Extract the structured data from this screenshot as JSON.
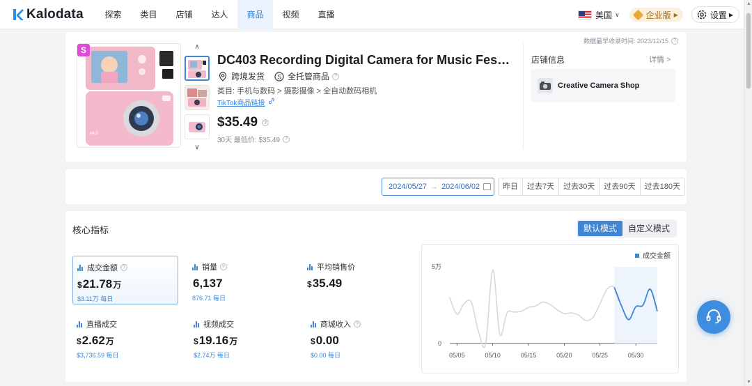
{
  "app": {
    "name": "Kalodata"
  },
  "nav": {
    "items": [
      {
        "label": "探索"
      },
      {
        "label": "类目"
      },
      {
        "label": "店铺"
      },
      {
        "label": "达人"
      },
      {
        "label": "商品"
      },
      {
        "label": "视频"
      },
      {
        "label": "直播"
      }
    ],
    "active_index": 4,
    "country": "美国",
    "enterprise": "企业版",
    "settings": "设置"
  },
  "timestamp": "数据最早收录时间: 2023/12/15",
  "product": {
    "badge": "S",
    "title": "DC403 Recording Digital Camera for Music Festiva...",
    "shipping": "跨境发货",
    "managed": "全托管商品",
    "category": "类目: 手机与数码 > 摄影摄像 > 全自动数码相机",
    "tiktok_link": "TikTok商品链接",
    "price": "$35.49",
    "low_price": "30天 最低价: $35.49",
    "image_text": "44.0"
  },
  "shop": {
    "label": "店铺信息",
    "detail": "详情 >",
    "name": "Creative Camera Shop"
  },
  "date": {
    "start": "2024/05/27",
    "end": "2024/06/02",
    "quick": [
      "昨日",
      "过去7天",
      "过去30天",
      "过去90天",
      "过去180天"
    ]
  },
  "metrics_section": {
    "title": "核心指标",
    "modes": [
      "默认模式",
      "自定义模式"
    ],
    "items": [
      {
        "label": "成交金额",
        "currency": "$",
        "value": "21.78",
        "unit": "万",
        "sub": "$3.11万 每日",
        "help": true
      },
      {
        "label": "销量",
        "currency": "",
        "value": "6,137",
        "unit": "",
        "sub": "876.71 每日",
        "help": true
      },
      {
        "label": "平均销售价",
        "currency": "$",
        "value": "35.49",
        "unit": "",
        "sub": "",
        "help": false
      },
      {
        "label": "直播成交",
        "currency": "$",
        "value": "2.62",
        "unit": "万",
        "sub": "$3,736.59 每日",
        "help": false
      },
      {
        "label": "视频成交",
        "currency": "$",
        "value": "19.16",
        "unit": "万",
        "sub": "$2.74万 每日",
        "help": false
      },
      {
        "label": "商城收入",
        "currency": "$",
        "value": "0.00",
        "unit": "",
        "sub": "$0.00 每日",
        "help": true
      }
    ]
  },
  "colors": {
    "accent": "#3f85d6",
    "highlight_line": "#3f85d6",
    "base_line": "#d6d8dc"
  },
  "chart_data": {
    "type": "line",
    "legend": [
      "成交金额"
    ],
    "legend_position": "top-right",
    "x_tick_labels": [
      "05/05",
      "05/10",
      "05/15",
      "05/20",
      "05/25",
      "05/30"
    ],
    "y_tick_labels": [
      "5万",
      "0"
    ],
    "ylim": [
      0,
      50000
    ],
    "series": [
      {
        "name": "成交金额",
        "x": [
          "05/04",
          "05/05",
          "05/06",
          "05/07",
          "05/08",
          "05/09",
          "05/10",
          "05/11",
          "05/12",
          "05/13",
          "05/14",
          "05/15",
          "05/16",
          "05/17",
          "05/18",
          "05/19",
          "05/20",
          "05/21",
          "05/22",
          "05/23",
          "05/24",
          "05/25",
          "05/26",
          "05/27",
          "05/28",
          "05/29",
          "05/30",
          "05/31",
          "06/01",
          "06/02"
        ],
        "values": [
          30000,
          19000,
          26000,
          27000,
          8000,
          -500,
          48000,
          6000,
          20000,
          20500,
          21000,
          23500,
          24500,
          27000,
          25500,
          22000,
          19500,
          20000,
          18500,
          15000,
          17000,
          26000,
          35500,
          36500,
          24500,
          15500,
          24000,
          25000,
          35500,
          21000
        ],
        "highlight_from": "05/27"
      }
    ]
  }
}
